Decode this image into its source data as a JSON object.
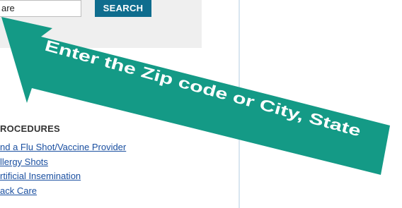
{
  "search": {
    "input_value": "are",
    "button_label": "SEARCH"
  },
  "procedures": {
    "heading": "ROCEDURES",
    "items": [
      {
        "label": "nd a Flu Shot/Vaccine Provider"
      },
      {
        "label": "llergy Shots"
      },
      {
        "label": "rtificial Insemination"
      },
      {
        "label": "ack Care"
      }
    ]
  },
  "annotation": {
    "text": "Enter the Zip code or City, State",
    "arrow_color": "#149a86",
    "text_color": "#ffffff"
  },
  "colors": {
    "search_button": "#0f6d8e",
    "link": "#1a4fa0",
    "panel_bg": "#efefef"
  }
}
